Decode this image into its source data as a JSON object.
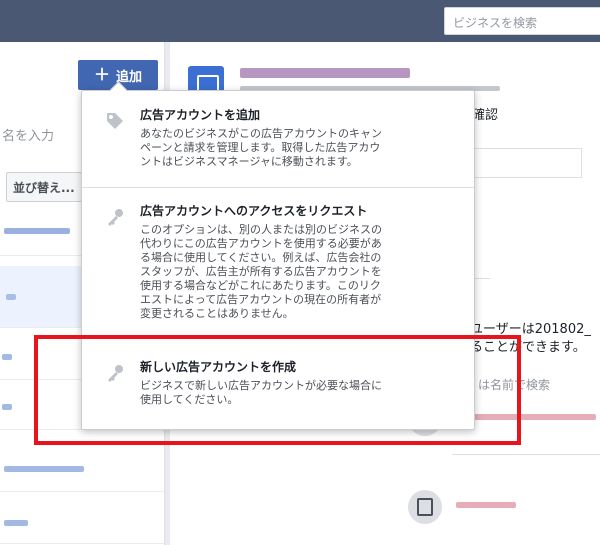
{
  "header": {
    "search_placeholder": "ビジネスを検索"
  },
  "sidebar": {
    "add_label": "追加",
    "filter_placeholder": "名を入力",
    "sort_label": "並び替え..."
  },
  "main": {
    "confirm_text": "確認",
    "user_text": "ユーザーは201802_",
    "can_text": "ることができます。",
    "search_text": "は名前で検索"
  },
  "menu": {
    "items": [
      {
        "title": "広告アカウントを追加",
        "desc_lines": [
          "あなたのビジネスがこの広告アカウントのキャン",
          "ペーンと請求を管理します。取得した広告アカウ",
          "ントはビジネスマネージャに移動されます。"
        ],
        "icon": "tag-icon"
      },
      {
        "title": "広告アカウントへのアクセスをリクエスト",
        "desc_lines": [
          "このオプションは、別の人または別のビジネスの",
          "代わりにこの広告アカウントを使用する必要があ",
          "る場合に使用してください。例えば、広告会社の",
          "スタッフが、広告主が所有する広告アカウントを",
          "使用する場合などがこれにあたります。このリク",
          "エストによって広告アカウントの現在の所有者が",
          "変更されることはありません。"
        ],
        "icon": "key-icon"
      },
      {
        "title": "新しい広告アカウントを作成",
        "desc_lines": [
          "ビジネスで新しい広告アカウントが必要な場合に",
          "使用してください。"
        ],
        "icon": "key-icon"
      }
    ]
  },
  "colors": {
    "accent": "#4267b2",
    "highlight": "#e8141c",
    "topbar": "#4a5873"
  }
}
